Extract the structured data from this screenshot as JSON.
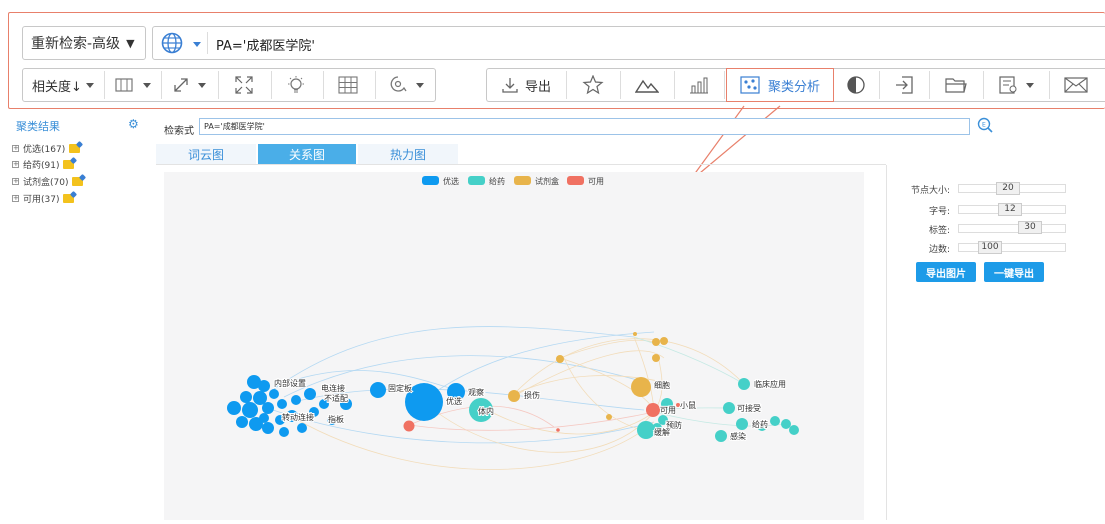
{
  "search": {
    "mode_label": "重新检索-高级",
    "query": "PA='成都医学院'"
  },
  "toolbar": {
    "sort_label": "相关度↓",
    "export_label": "导出",
    "cluster_label": "聚类分析"
  },
  "left": {
    "title": "聚类结果",
    "items": [
      {
        "label": "优选(167)"
      },
      {
        "label": "给药(91)"
      },
      {
        "label": "试剂盒(70)"
      },
      {
        "label": "可用(37)"
      }
    ]
  },
  "expr": {
    "label": "检索式",
    "value": "PA='成都医学院'"
  },
  "tabs": [
    {
      "label": "词云图"
    },
    {
      "label": "关系图"
    },
    {
      "label": "热力图"
    }
  ],
  "legend": [
    {
      "name": "优选",
      "color": "#0e9af0"
    },
    {
      "name": "给药",
      "color": "#45d0c8"
    },
    {
      "name": "试剂盒",
      "color": "#e8b44b"
    },
    {
      "name": "可用",
      "color": "#f07162"
    }
  ],
  "controls": {
    "node_size_label": "节点大小:",
    "node_size": "20",
    "font_label": "字号:",
    "font": "12",
    "tags_label": "标签:",
    "tags": "30",
    "edges_label": "边数:",
    "edges": "100",
    "export_image": "导出图片",
    "export_all": "一键导出"
  },
  "graph_labels": {
    "n1": "内部设置",
    "n2": "电连接",
    "n3": "不适配",
    "n4": "指板",
    "n5": "固定板",
    "n6": "观察",
    "n7": "优选",
    "n8": "体内",
    "n9": "损伤",
    "n10": "细胞",
    "n11": "临床应用",
    "n12": "小鼠",
    "n13": "可用",
    "n14": "可接受",
    "n15": "预防",
    "n16": "给药",
    "n17": "缓解",
    "n18": "感染",
    "n19": "转动连接"
  }
}
